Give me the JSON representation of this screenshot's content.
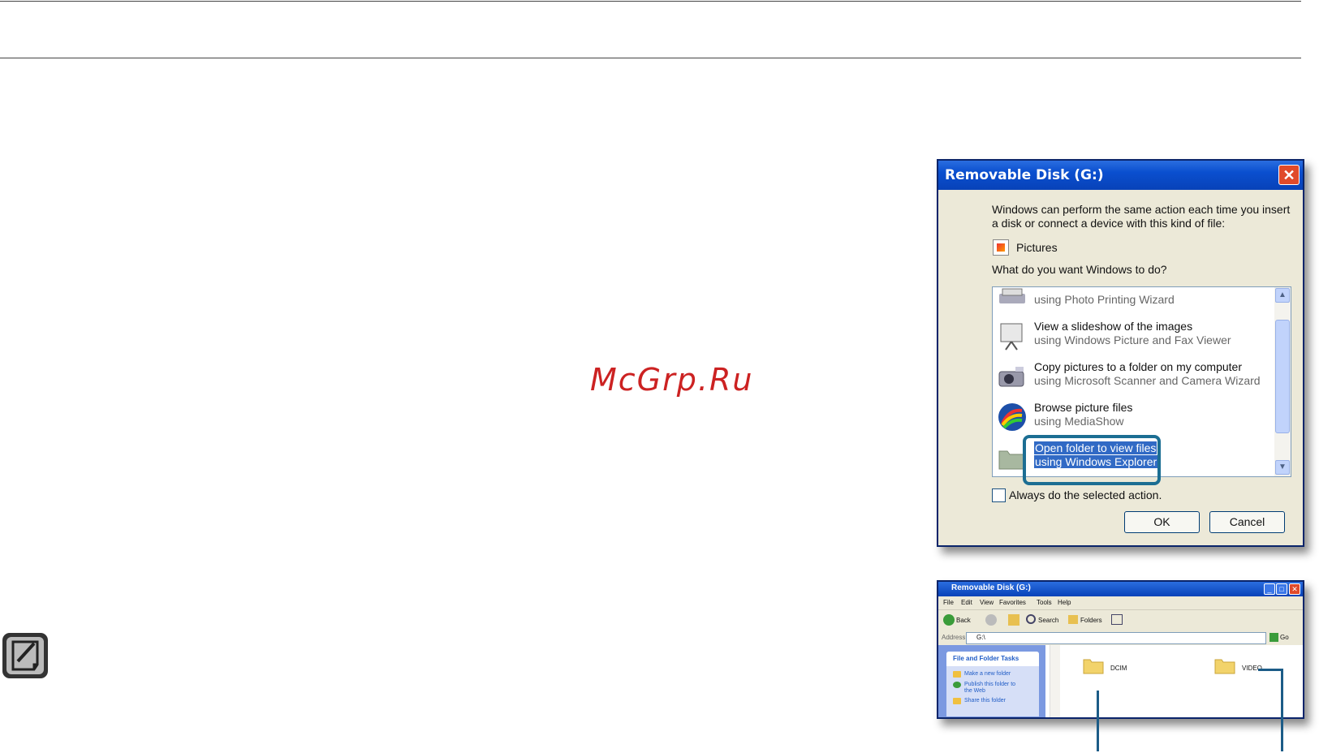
{
  "watermark": "McGrp.Ru",
  "dialog": {
    "title": "Removable Disk (G:)",
    "close": "✕",
    "intro_line1": "Windows can perform the same action each time you insert",
    "intro_line2": "a disk or connect a device with this kind of file:",
    "content_type": "Pictures",
    "question": "What do you want Windows to do?",
    "actions": [
      {
        "line1": "",
        "line2": "using Photo Printing Wizard",
        "icon": "printer-icon"
      },
      {
        "line1": "View a slideshow of the images",
        "line2": "using Windows Picture and Fax Viewer",
        "icon": "projector-screen-icon"
      },
      {
        "line1": "Copy pictures to a folder on my computer",
        "line2": "using Microsoft Scanner and Camera Wizard",
        "icon": "camera-icon"
      },
      {
        "line1": "Browse picture files",
        "line2": "using MediaShow",
        "icon": "mediashow-icon"
      },
      {
        "line1": "Open folder to view files",
        "line2": "using Windows Explorer",
        "icon": "folder-icon",
        "selected": true
      }
    ],
    "always_label": "Always do the selected action.",
    "ok": "OK",
    "cancel": "Cancel"
  },
  "explorer": {
    "title": "Removable Disk (G:)",
    "menus": [
      "File",
      "Edit",
      "View",
      "Favorites",
      "Tools",
      "Help"
    ],
    "toolbar": {
      "back": "Back",
      "search": "Search",
      "folders": "Folders"
    },
    "address_label": "Address",
    "address_value": "G:\\",
    "go": "Go",
    "tasks_header": "File and Folder Tasks",
    "tasks": [
      "Make a new folder",
      "Publish this folder to",
      "the Web",
      "Share this folder"
    ],
    "folders": [
      "DCIM",
      "VIDEO"
    ]
  }
}
